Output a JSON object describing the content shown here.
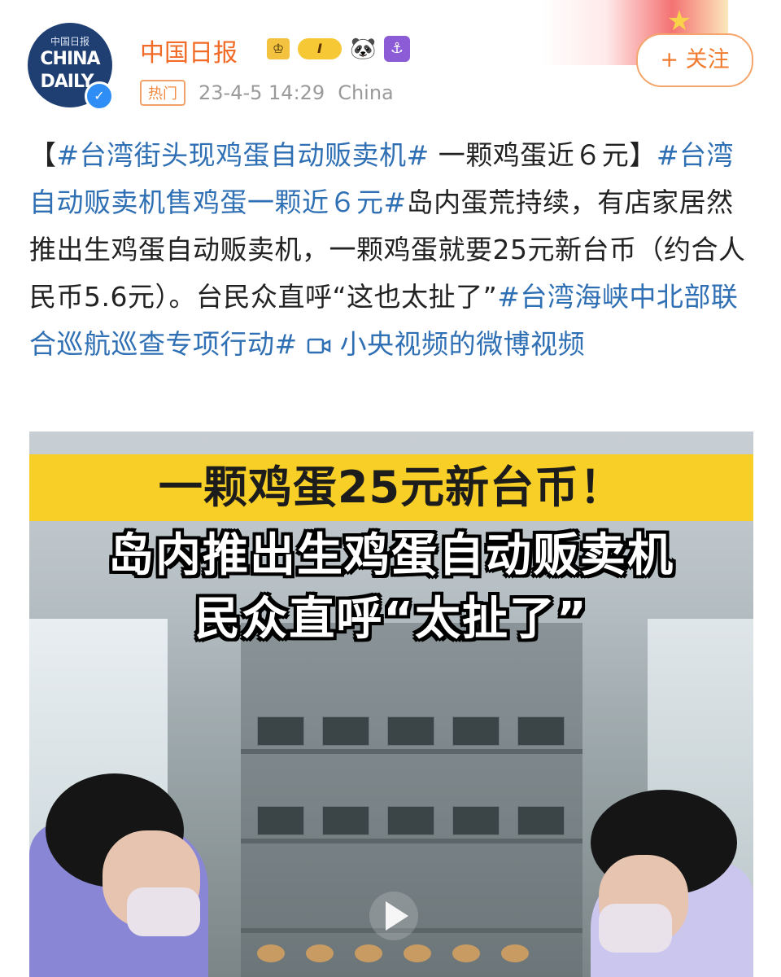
{
  "account": {
    "avatar_text_top": "中国日报",
    "avatar_text_1": "CHINA",
    "avatar_text_2": "DAILY",
    "name": "中国日报",
    "level_badge": "I",
    "verified_icon": "verified-icon"
  },
  "meta": {
    "hot_label": "热门",
    "time": "23-4-5 14:29",
    "location": "China"
  },
  "follow_button": "+ 关注",
  "post": {
    "bracket_open": "【",
    "tag1": "#台湾街头现鸡蛋自动贩卖机#",
    "headline": " 一颗鸡蛋近６元",
    "bracket_close": "】",
    "tag2": "#台湾自动贩卖机售鸡蛋一颗近６元#",
    "body": "岛内蛋荒持续，有店家居然推出生鸡蛋自动贩卖机，一颗鸡蛋就要25元新台币（约合人民币5.6元）。台民众直呼“这也太扯了”",
    "tag3": "#台湾海峡中北部联合巡航巡查专项行动#",
    "video_icon": "video-icon",
    "video_link": "小央视频的微博视频"
  },
  "video": {
    "banner": "一颗鸡蛋25元新台币！",
    "subtitle1": "岛内推出生鸡蛋自动贩卖机",
    "subtitle2": "民众直呼“太扯了”",
    "play_icon": "play-icon"
  },
  "colors": {
    "name_orange": "#f26b26",
    "link_blue": "#2f6fb4",
    "banner_yellow": "#f7cf26"
  }
}
